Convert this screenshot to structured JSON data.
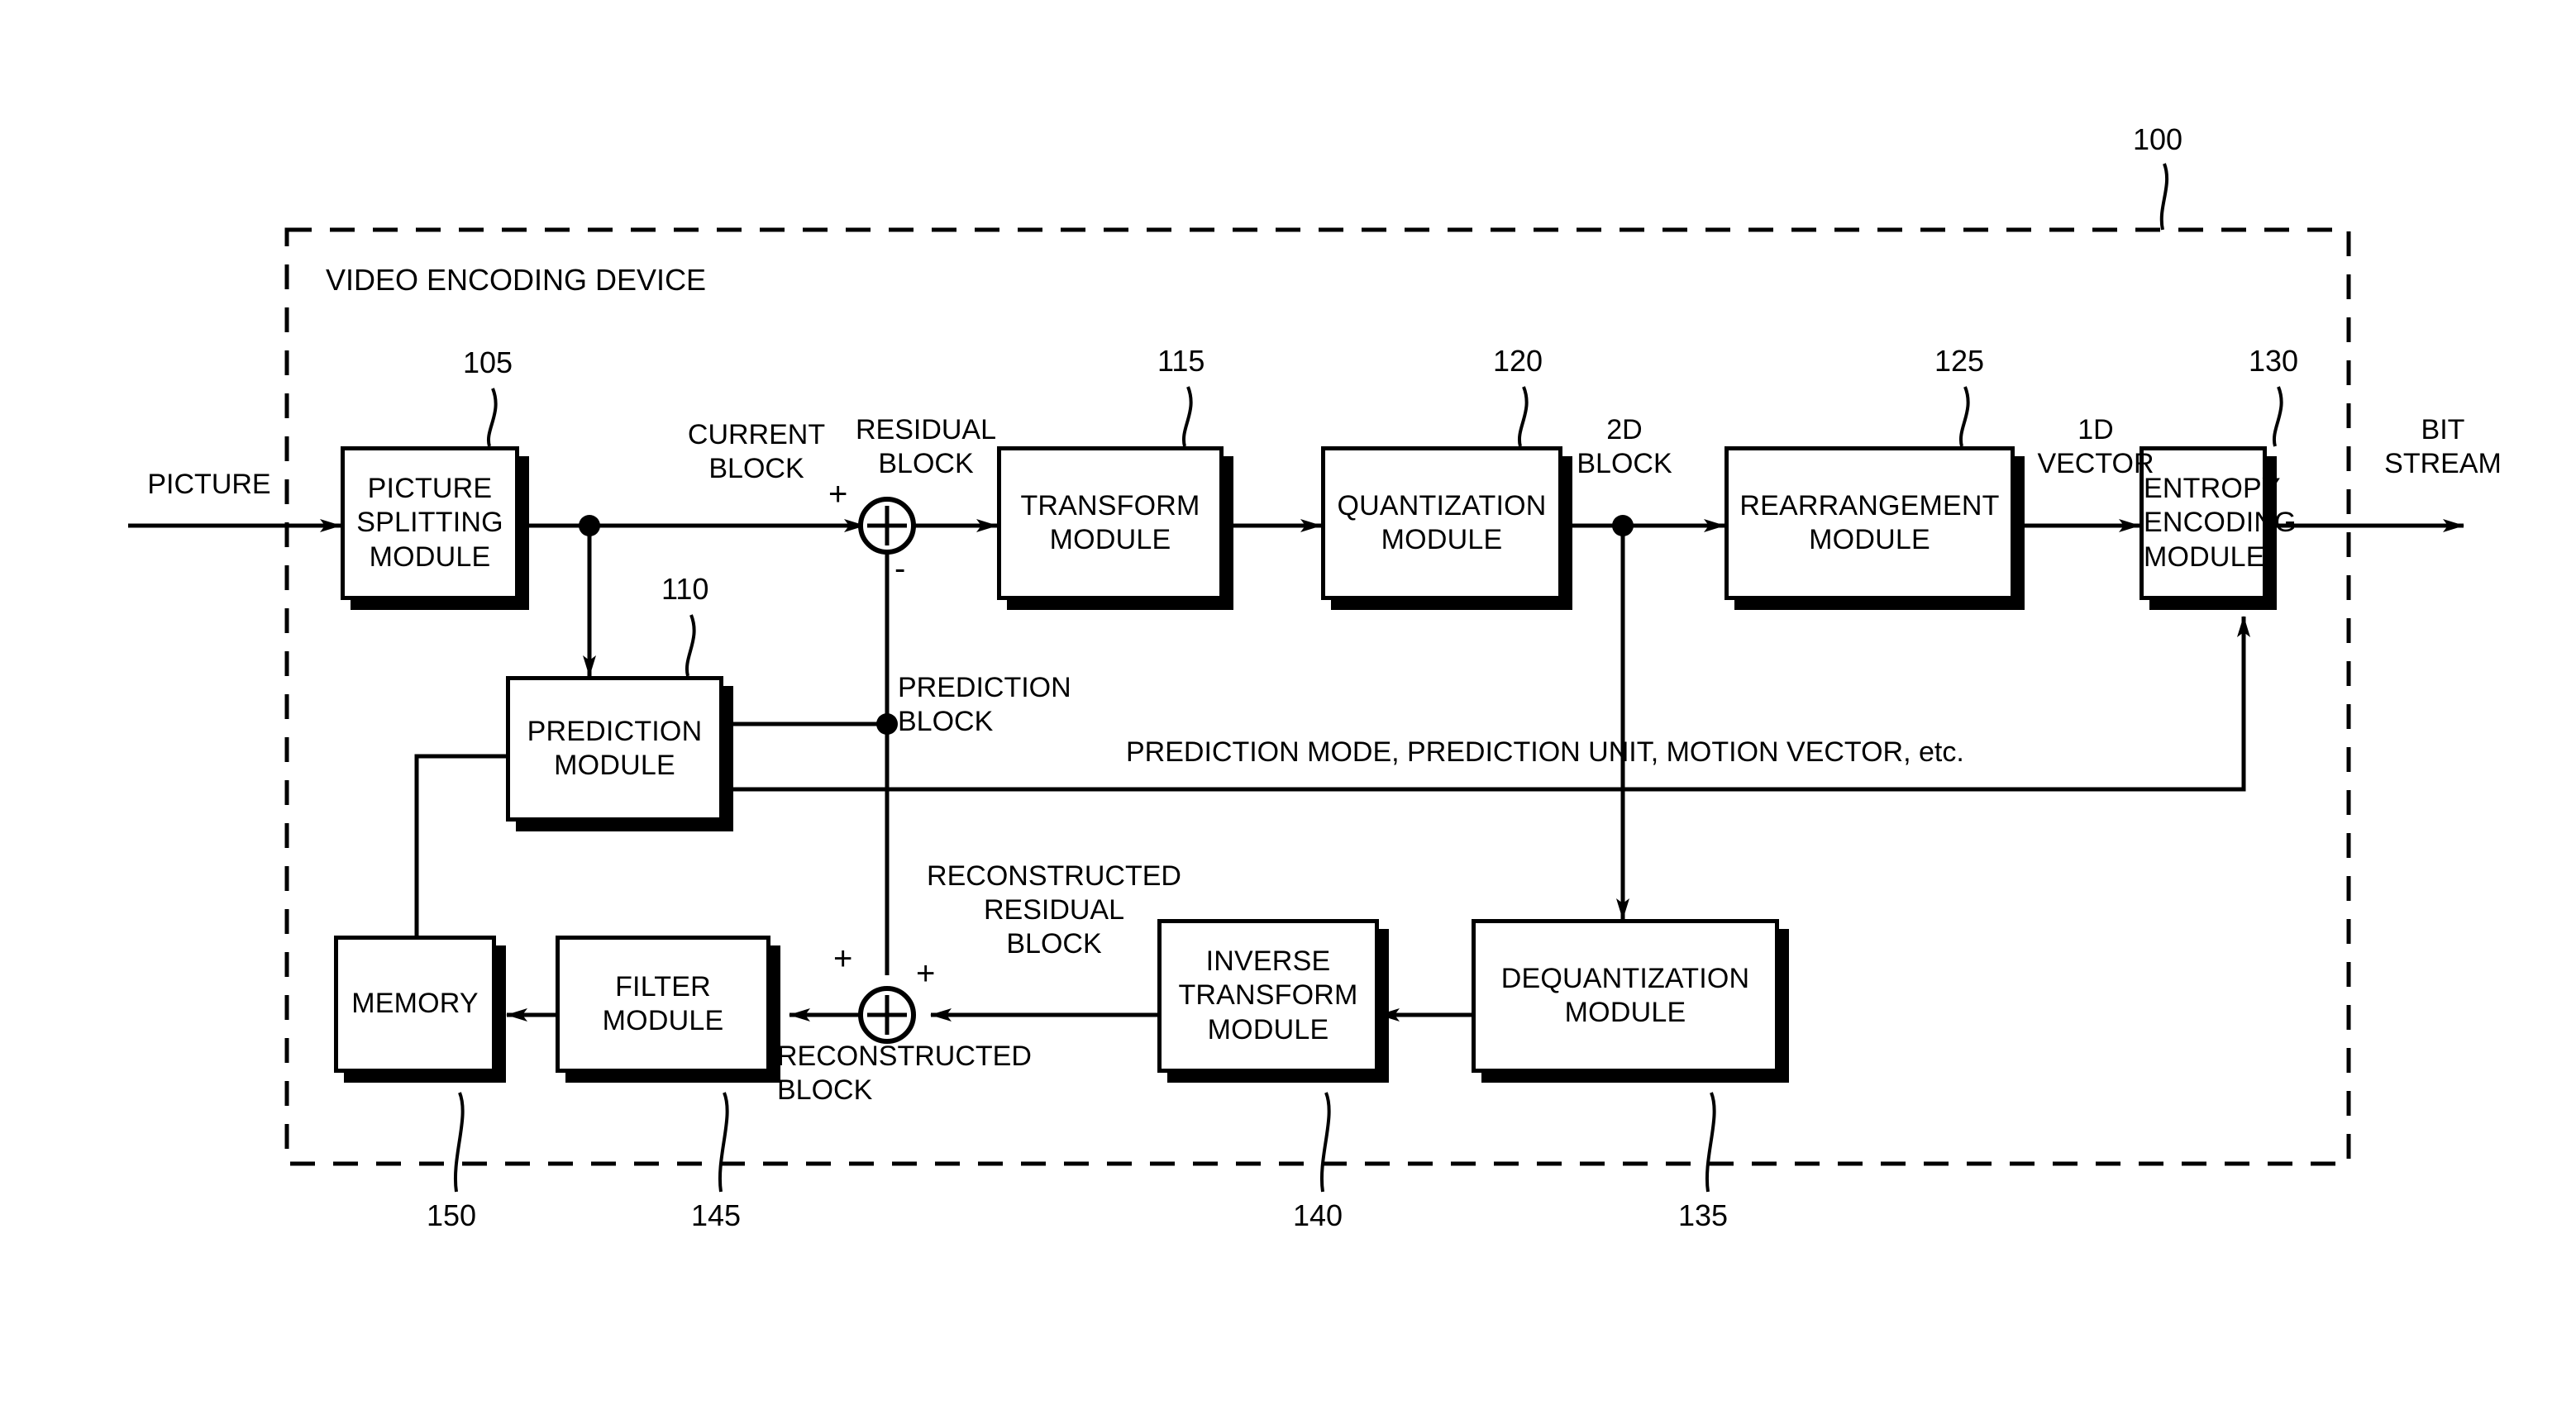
{
  "figure": {
    "device_label": "VIDEO ENCODING DEVICE",
    "device_ref": "100"
  },
  "modules": [
    {
      "id": "picture-splitting",
      "label": "PICTURE\nSPLITTING\nMODULE",
      "ref": "105"
    },
    {
      "id": "prediction",
      "label": "PREDICTION\nMODULE",
      "ref": "110"
    },
    {
      "id": "transform",
      "label": "TRANSFORM\nMODULE",
      "ref": "115"
    },
    {
      "id": "quantization",
      "label": "QUANTIZATION\nMODULE",
      "ref": "120"
    },
    {
      "id": "rearrangement",
      "label": "REARRANGEMENT\nMODULE",
      "ref": "125"
    },
    {
      "id": "entropy-encoding",
      "label": "ENTROPY\nENCODING\nMODULE",
      "ref": "130"
    },
    {
      "id": "dequantization",
      "label": "DEQUANTIZATION\nMODULE",
      "ref": "135"
    },
    {
      "id": "inverse-transform",
      "label": "INVERSE\nTRANSFORM\nMODULE",
      "ref": "140"
    },
    {
      "id": "filter",
      "label": "FILTER\nMODULE",
      "ref": "145"
    },
    {
      "id": "memory",
      "label": "MEMORY",
      "ref": "150"
    }
  ],
  "signals": {
    "picture": "PICTURE",
    "current_block": "CURRENT\nBLOCK",
    "residual_block": "RESIDUAL\nBLOCK",
    "block_2d": "2D\nBLOCK",
    "vector_1d": "1D\nVECTOR",
    "bit_stream": "BIT\nSTREAM",
    "prediction_block": "PREDICTION\nBLOCK",
    "prediction_info": "PREDICTION MODE, PREDICTION UNIT, MOTION VECTOR, etc.",
    "reconstructed_residual_block": "RECONSTRUCTED\nRESIDUAL\nBLOCK",
    "reconstructed_block": "RECONSTRUCTED\nBLOCK"
  },
  "operators": {
    "subtractor": {
      "plus": "+",
      "minus": "-"
    },
    "adder": {
      "plus_top": "+",
      "plus_right": "+"
    }
  },
  "colors": {
    "line": "#000000",
    "background": "#ffffff",
    "box_fill": "#ffffff"
  }
}
